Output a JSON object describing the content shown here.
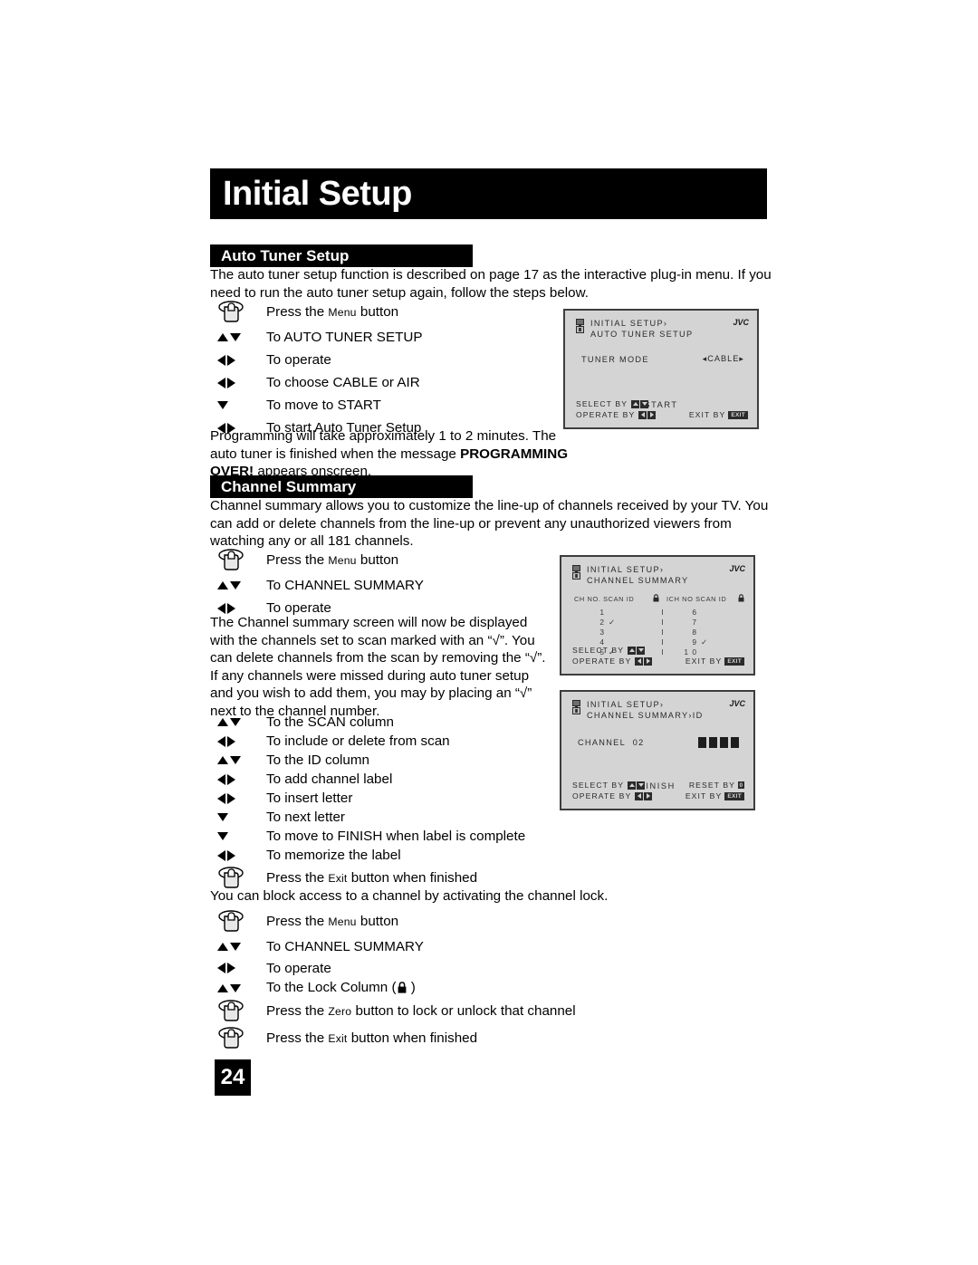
{
  "page": {
    "chapter_title": "Initial Setup",
    "page_number": "24"
  },
  "sections": {
    "auto_tuner": {
      "heading": "Auto Tuner Setup",
      "intro": "The auto tuner setup function is described on page 17 as the interactive plug-in menu.  If you need to run the auto tuner setup again, follow the steps below.",
      "steps": [
        {
          "icon": "hand-press-button-icon",
          "text_pre": "Press the ",
          "text_sc": "Menu",
          "text_post": " button"
        },
        {
          "icon": "up-down-arrows-icon",
          "text": "To AUTO TUNER SETUP"
        },
        {
          "icon": "left-right-arrows-icon",
          "text": "To operate"
        },
        {
          "icon": "left-right-arrows-icon",
          "text": "To choose CABLE or AIR"
        },
        {
          "icon": "down-arrow-icon",
          "text": "To move to START"
        },
        {
          "icon": "left-right-arrows-icon",
          "text": "To start Auto Tuner Setup"
        }
      ],
      "outro_plain_1": "Programming will take approximately 1 to 2 minutes.  The auto tuner is finished when the message ",
      "outro_bold": "PROGRAMMING OVER!",
      "outro_plain_2": " appears onscreen."
    },
    "channel_summary": {
      "heading": "Channel Summary",
      "intro": "Channel summary allows you to customize the line-up of channels received by your TV. You can add or delete channels from the line-up or prevent any unauthorized viewers from watching any or all 181 channels.",
      "steps_1": [
        {
          "icon": "hand-press-button-icon",
          "text_pre": "Press the ",
          "text_sc": "Menu",
          "text_post": " button"
        },
        {
          "icon": "up-down-arrows-icon",
          "text": "To CHANNEL SUMMARY"
        },
        {
          "icon": "left-right-arrows-icon",
          "text": "To operate"
        }
      ],
      "body_2": "The Channel summary screen will now be displayed with the channels set to scan marked with an “√”. You can delete channels from the scan by removing the “√”. If any channels were missed during auto tuner setup and you wish to add them, you may by placing an “√” next to the channel number.",
      "steps_2": [
        {
          "icon": "up-down-arrows-icon",
          "text": "To the SCAN column"
        },
        {
          "icon": "left-right-arrows-icon",
          "text": "To include or delete from scan"
        },
        {
          "icon": "up-down-arrows-icon",
          "text": "To the ID column"
        },
        {
          "icon": "left-right-arrows-icon",
          "text": "To add channel label"
        },
        {
          "icon": "left-right-arrows-icon",
          "text": "To insert letter"
        },
        {
          "icon": "down-arrow-icon",
          "text": "To next letter"
        },
        {
          "icon": "down-arrow-icon",
          "text": "To move to FINISH when label is complete"
        },
        {
          "icon": "left-right-arrows-icon",
          "text": "To memorize the label"
        },
        {
          "icon": "hand-press-button-icon",
          "text_pre": "Press the ",
          "text_sc": "Exit",
          "text_post": " button when finished"
        }
      ],
      "body_3": "You can block access to a channel by activating the channel lock.",
      "steps_3": [
        {
          "icon": "hand-press-button-icon",
          "text_pre": "Press the ",
          "text_sc": "Menu",
          "text_post": " button"
        },
        {
          "icon": "up-down-arrows-icon",
          "text": "To CHANNEL SUMMARY"
        },
        {
          "icon": "left-right-arrows-icon",
          "text": "To operate"
        },
        {
          "icon": "up-down-arrows-icon",
          "text_pre": "To the Lock Column (",
          "text_icon": "lock-icon",
          "text_post": " )"
        },
        {
          "icon": "hand-press-button-icon",
          "text_pre": "Press the ",
          "text_sc": "Zero",
          "text_post": " button to lock or unlock that channel"
        },
        {
          "icon": "hand-press-button-icon",
          "text_pre": "Press the ",
          "text_sc": "Exit",
          "text_post": " button when finished"
        }
      ]
    }
  },
  "osd_panels": {
    "auto_tuner": {
      "brand": "JVC",
      "header_line_1": "INITIAL SETUP›",
      "header_line_2": "AUTO TUNER SETUP",
      "setting_label": "TUNER MODE",
      "setting_value": "CABLE",
      "setting_left_arrow": "◂",
      "setting_right_arrow": "▸",
      "action_label": "START",
      "footer": {
        "select_label": "SELECT   BY",
        "operate_label": "OPERATE BY",
        "exit_label": "EXIT BY",
        "exit_key": "EXIT"
      }
    },
    "channel_summary": {
      "brand": "JVC",
      "header_line_1": "INITIAL SETUP›",
      "header_line_2": "CHANNEL SUMMARY",
      "table": {
        "left_header": "CH NO. SCAN ID",
        "right_header": "CH NO SCAN ID",
        "lock_header_icon": "lock-icon",
        "separator": "I",
        "left_rows": [
          {
            "channel": "1",
            "scan": ""
          },
          {
            "channel": "2",
            "scan": "✓"
          },
          {
            "channel": "3",
            "scan": ""
          },
          {
            "channel": "4",
            "scan": ""
          },
          {
            "channel": "5",
            "scan": "✓"
          }
        ],
        "right_rows": [
          {
            "channel": "6",
            "scan": ""
          },
          {
            "channel": "7",
            "scan": ""
          },
          {
            "channel": "8",
            "scan": ""
          },
          {
            "channel": "9",
            "scan": "✓"
          },
          {
            "channel": "1 0",
            "scan": ""
          }
        ]
      },
      "footer": {
        "select_label": "SELECT   BY",
        "operate_label": "OPERATE BY",
        "exit_label": "EXIT BY",
        "exit_key": "EXIT"
      }
    },
    "channel_summary_id": {
      "brand": "JVC",
      "header_line_1": "INITIAL SETUP›",
      "header_line_2": "CHANNEL SUMMARY›ID",
      "channel_label": "CHANNEL",
      "channel_value": "02",
      "label_blocks": 4,
      "action_label": "FINISH",
      "footer": {
        "select_label": "SELECT   BY",
        "operate_label": "OPERATE BY",
        "reset_label": "RESET BY",
        "reset_key": "0",
        "exit_label": "EXIT BY",
        "exit_key": "EXIT"
      }
    }
  }
}
